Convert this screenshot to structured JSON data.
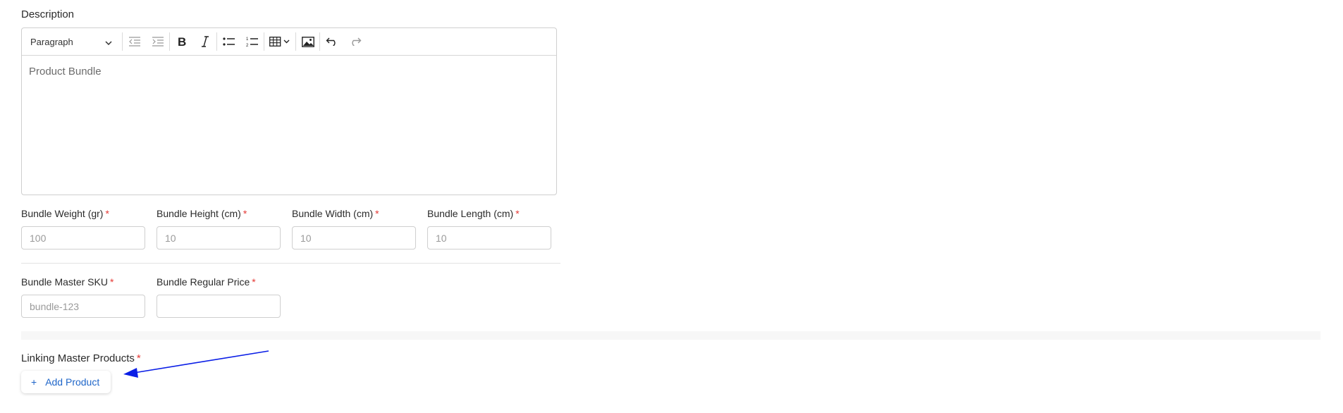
{
  "description": {
    "label": "Description",
    "toolbar": {
      "format_select": "Paragraph"
    },
    "content": "Product Bundle"
  },
  "dimensions": [
    {
      "label": "Bundle Weight (gr)",
      "required": "*",
      "placeholder": "100"
    },
    {
      "label": "Bundle Height (cm)",
      "required": "*",
      "placeholder": "10"
    },
    {
      "label": "Bundle Width (cm)",
      "required": "*",
      "placeholder": "10"
    },
    {
      "label": "Bundle Length (cm)",
      "required": "*",
      "placeholder": "10"
    }
  ],
  "sku": {
    "label": "Bundle Master SKU",
    "required": "*",
    "placeholder": "bundle-123"
  },
  "price": {
    "label": "Bundle Regular Price",
    "required": "*",
    "placeholder": ""
  },
  "linking": {
    "label": "Linking Master Products",
    "required": "*",
    "add_button_icon": "+",
    "add_button_label": "Add Product"
  },
  "colors": {
    "accent": "#1f66c9",
    "required": "#e53935",
    "arrow": "#0a1ee6"
  }
}
